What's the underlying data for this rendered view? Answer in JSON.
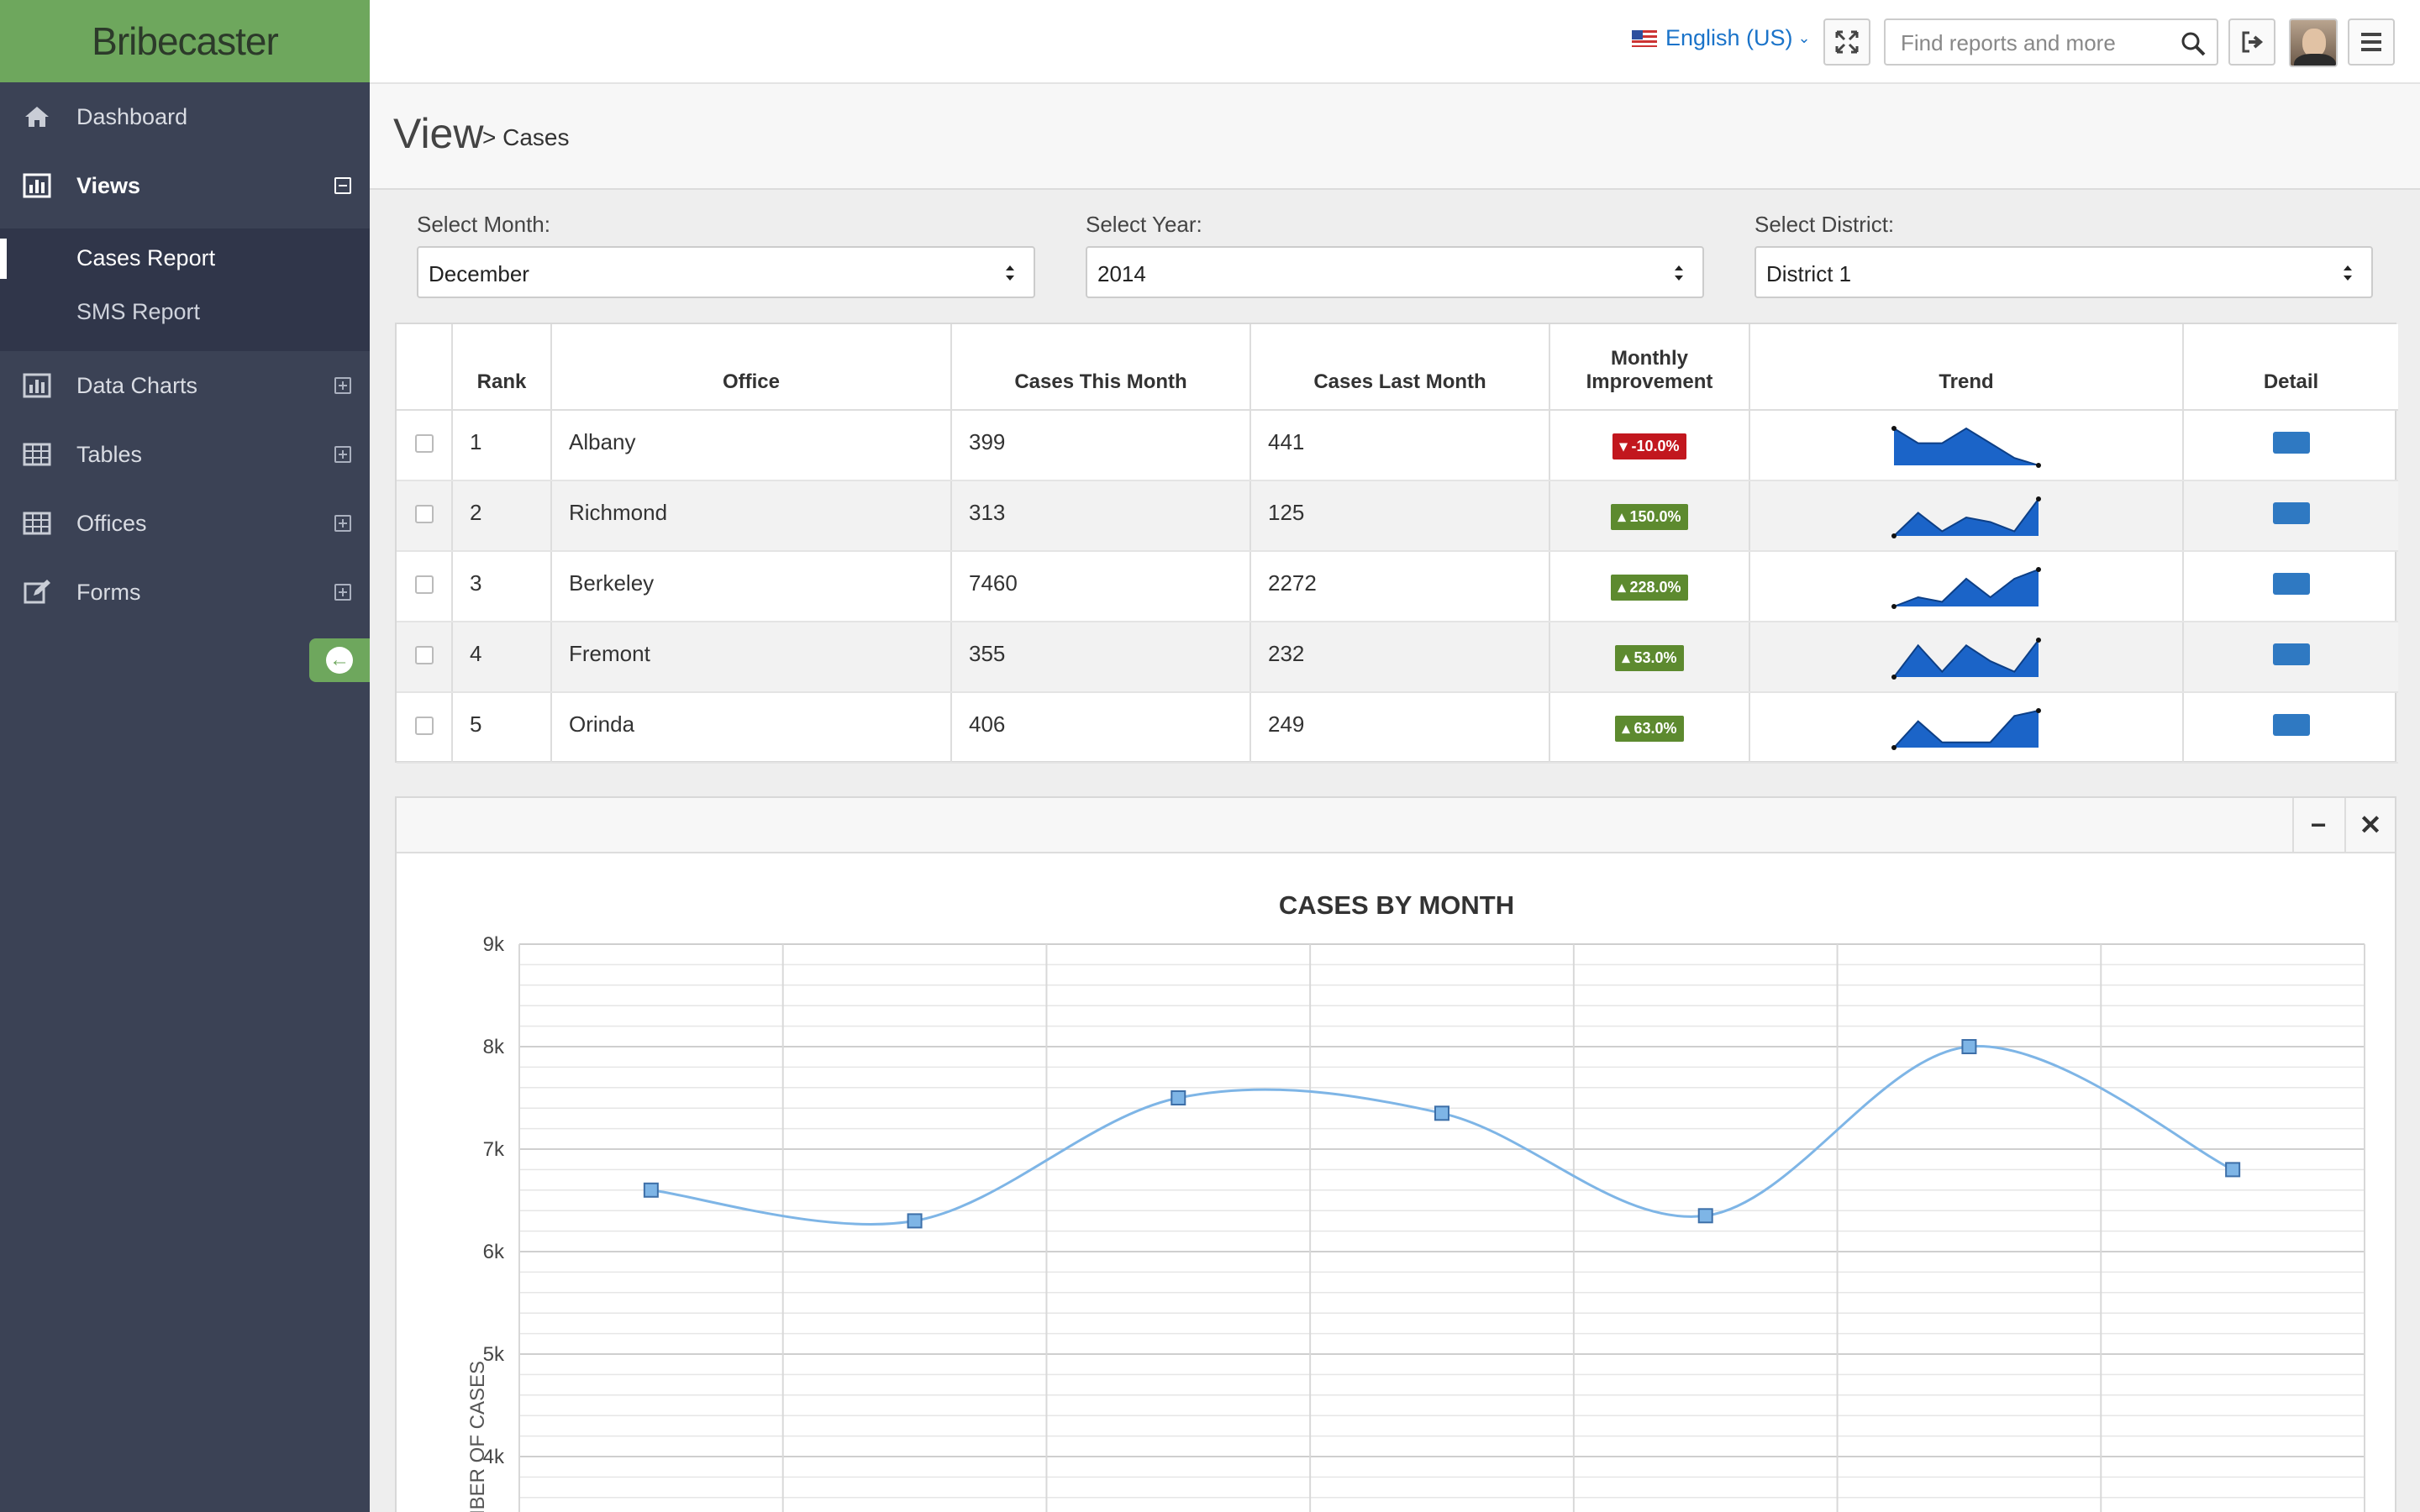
{
  "sidebar": {
    "brand": "Bribecaster",
    "items": [
      {
        "label": "Dashboard",
        "icon": "home-icon"
      },
      {
        "label": "Views",
        "icon": "bar-chart-icon"
      },
      {
        "label": "Data Charts",
        "icon": "bar-chart-icon"
      },
      {
        "label": "Tables",
        "icon": "table-icon"
      },
      {
        "label": "Offices",
        "icon": "table-icon"
      },
      {
        "label": "Forms",
        "icon": "edit-icon"
      }
    ],
    "subitems": [
      "Cases Report",
      "SMS Report"
    ],
    "accent": "#6ea75d",
    "background": "#3b4255"
  },
  "topbar": {
    "language": "English (US)",
    "search_placeholder": "Find reports and more"
  },
  "page": {
    "title": "View",
    "crumb": "> Cases"
  },
  "filters": {
    "month": {
      "label": "Select Month:",
      "value": "December"
    },
    "year": {
      "label": "Select Year:",
      "value": "2014"
    },
    "district": {
      "label": "Select District:",
      "value": "District 1"
    }
  },
  "table": {
    "headers": {
      "rank": "Rank",
      "office": "Office",
      "this_month": "Cases This Month",
      "last_month": "Cases Last Month",
      "improvement_1": "Monthly",
      "improvement_2": "Improvement",
      "trend": "Trend",
      "detail": "Detail"
    },
    "rows": [
      {
        "rank": "1",
        "office": "Albany",
        "this_month": "399",
        "last_month": "441",
        "improvement": "-10.0%",
        "direction": "down",
        "trend": [
          5,
          3,
          3,
          5,
          3,
          1,
          0
        ]
      },
      {
        "rank": "2",
        "office": "Richmond",
        "this_month": "313",
        "last_month": "125",
        "improvement": "150.0%",
        "direction": "up",
        "trend": [
          0,
          5,
          1,
          4,
          3,
          1,
          8
        ]
      },
      {
        "rank": "3",
        "office": "Berkeley",
        "this_month": "7460",
        "last_month": "2272",
        "improvement": "228.0%",
        "direction": "up",
        "trend": [
          0,
          2,
          1,
          6,
          2,
          6,
          8
        ]
      },
      {
        "rank": "4",
        "office": "Fremont",
        "this_month": "355",
        "last_month": "232",
        "improvement": "53.0%",
        "direction": "up",
        "trend": [
          0,
          6,
          1,
          6,
          3,
          1,
          7
        ]
      },
      {
        "rank": "5",
        "office": "Orinda",
        "this_month": "406",
        "last_month": "249",
        "improvement": "63.0%",
        "direction": "up",
        "trend": [
          0,
          5,
          1,
          1,
          1,
          6,
          7
        ]
      }
    ],
    "colors": {
      "down": "#c2171e",
      "up": "#5d8a2f",
      "spark": "#1b64c8",
      "detail": "#2f79c2"
    }
  },
  "panel": {
    "minimize_glyph": "−",
    "close_glyph": "✕"
  },
  "chart_data": {
    "type": "line",
    "title": "CASES BY MONTH",
    "ylabel": "NUMBER OF CASES",
    "xlabel": "",
    "yticks": [
      "9k",
      "8k",
      "7k",
      "6k",
      "5k",
      "4k"
    ],
    "ylim_visible": [
      3500,
      9000
    ],
    "x": [
      1,
      2,
      3,
      4,
      5,
      6,
      7
    ],
    "values": [
      6600,
      6300,
      7500,
      7350,
      6350,
      8000,
      6800
    ],
    "color": "#7eb5e6",
    "grid": true
  }
}
